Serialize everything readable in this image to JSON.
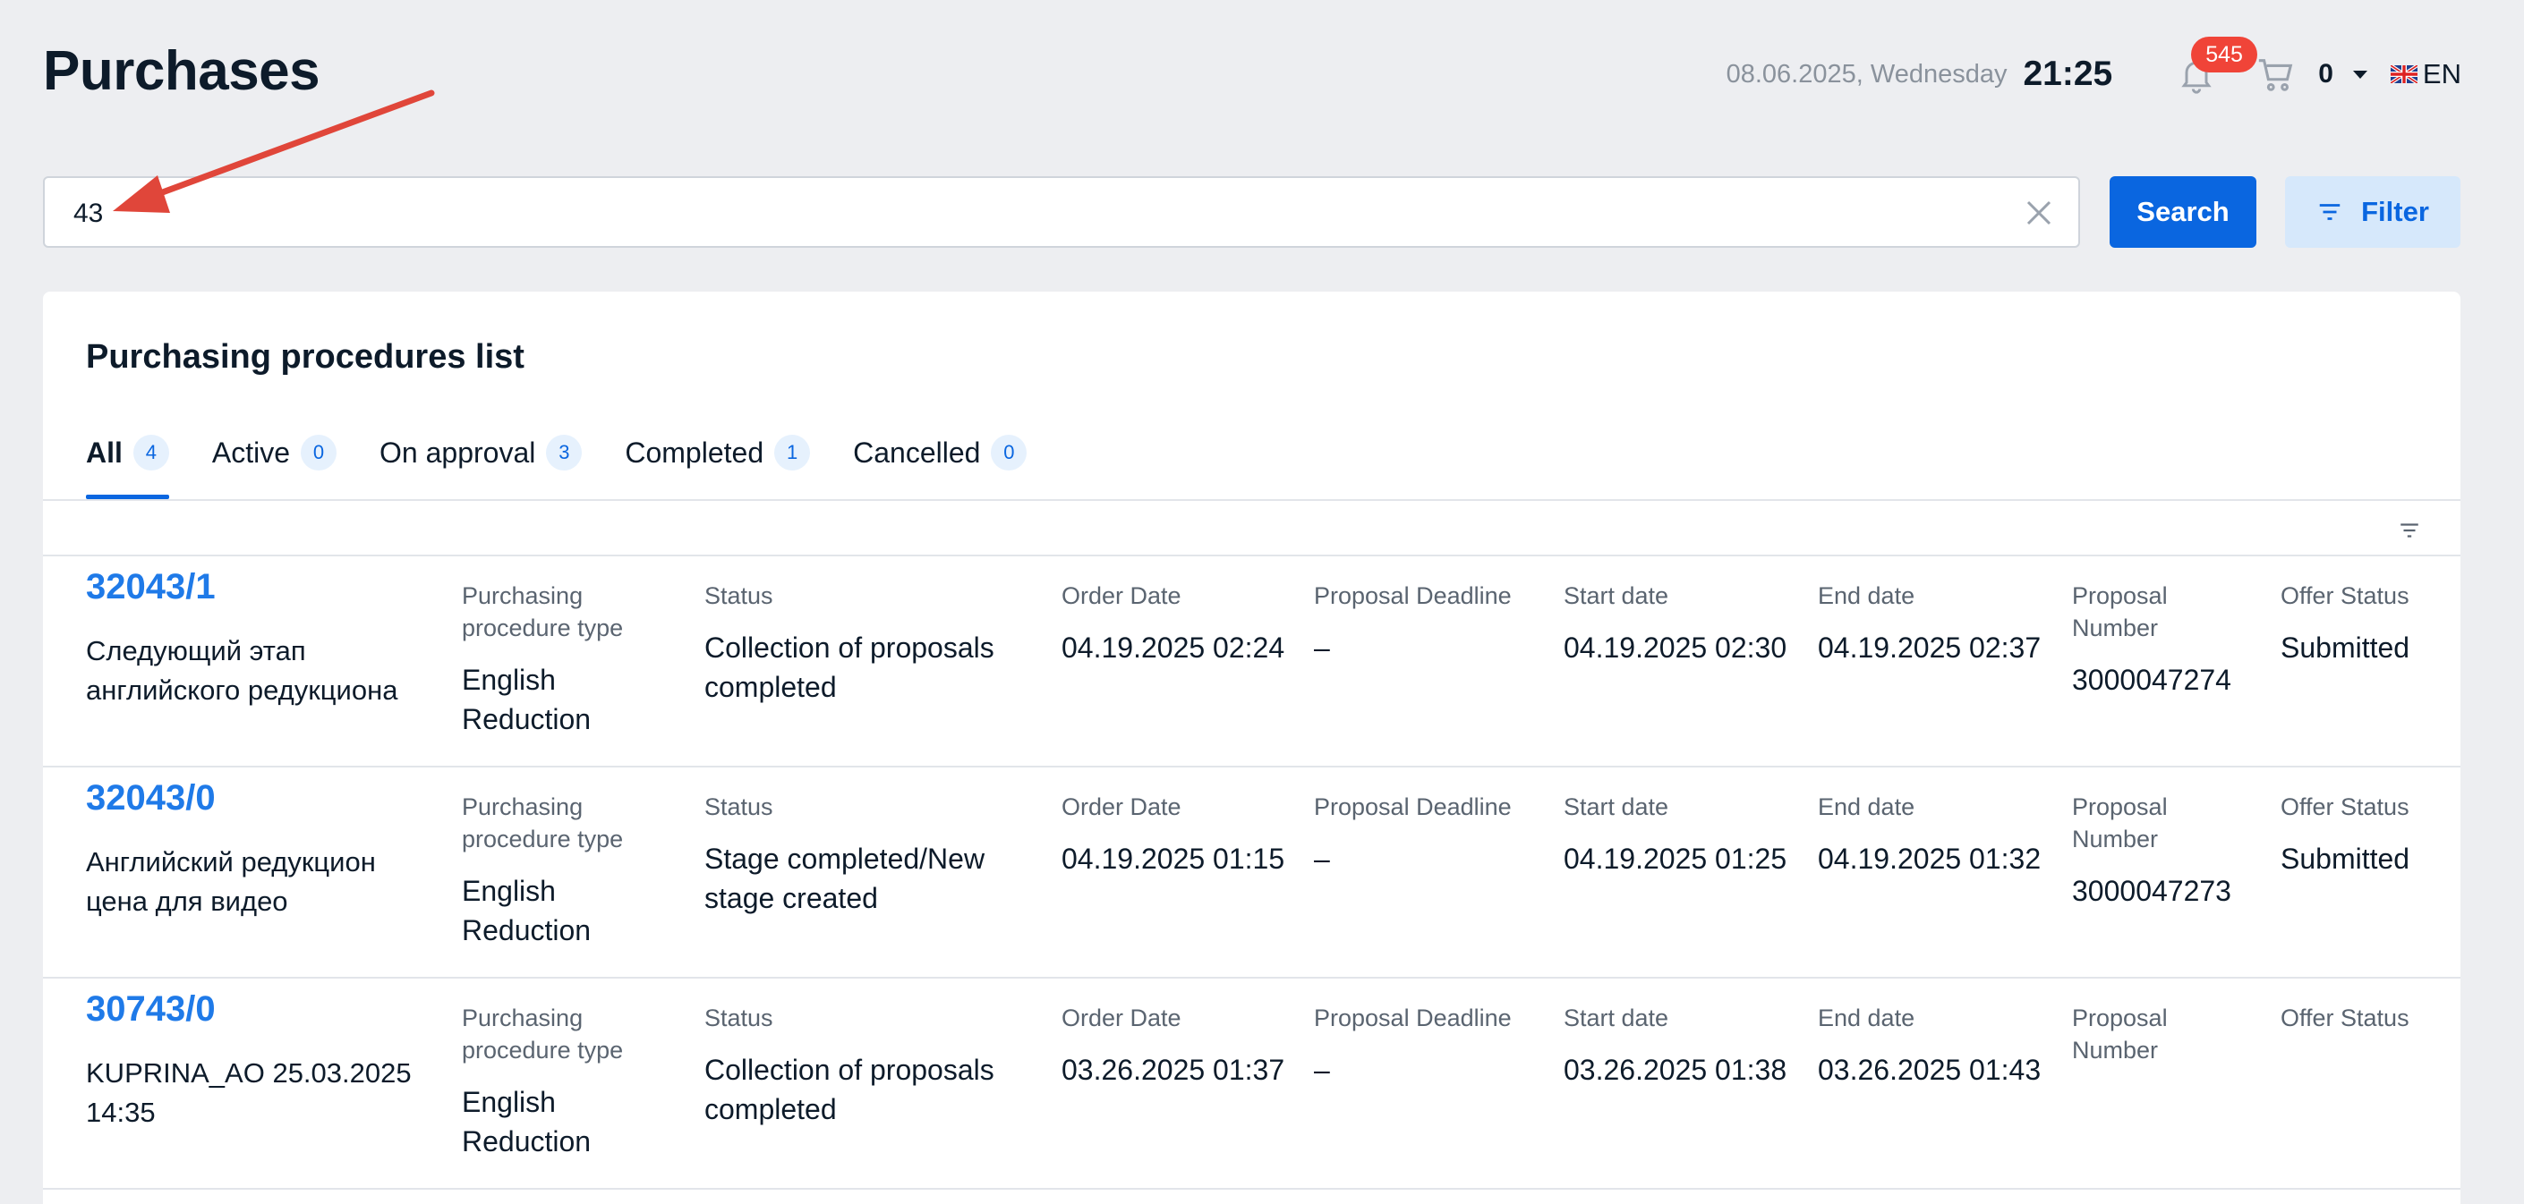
{
  "page": {
    "title": "Purchases"
  },
  "topbar": {
    "date": "08.06.2025, Wednesday",
    "time": "21:25",
    "notifications_count": "545",
    "cart_count": "0",
    "language": "EN"
  },
  "search": {
    "value": "43",
    "placeholder": "",
    "button_label": "Search"
  },
  "filter": {
    "label": "Filter"
  },
  "list": {
    "title": "Purchasing procedures list",
    "tabs": [
      {
        "label": "All",
        "count": "4"
      },
      {
        "label": "Active",
        "count": "0"
      },
      {
        "label": "On approval",
        "count": "3"
      },
      {
        "label": "Completed",
        "count": "1"
      },
      {
        "label": "Cancelled",
        "count": "0"
      }
    ],
    "headers": {
      "type": "Purchasing procedure type",
      "status": "Status",
      "order_date": "Order Date",
      "deadline": "Proposal Deadline",
      "start": "Start date",
      "end": "End date",
      "proposal_number": "Proposal Number",
      "offer_status": "Offer Status"
    },
    "rows": [
      {
        "id": "32043/1",
        "name": "Следующий этап английского редукциона",
        "type": "English Reduction",
        "status": "Collection of proposals completed",
        "order_date": "04.19.2025 02:24",
        "deadline": "–",
        "start": "04.19.2025 02:30",
        "end": "04.19.2025 02:37",
        "proposal_number": "3000047274",
        "offer_status": "Submitted"
      },
      {
        "id": "32043/0",
        "name": "Английский редукцион цена для видео",
        "type": "English Reduction",
        "status": "Stage completed/New stage created",
        "order_date": "04.19.2025 01:15",
        "deadline": "–",
        "start": "04.19.2025 01:25",
        "end": "04.19.2025 01:32",
        "proposal_number": "3000047273",
        "offer_status": "Submitted"
      },
      {
        "id": "30743/0",
        "name": "KUPRINA_AO 25.03.2025 14:35",
        "type": "English Reduction",
        "status": "Collection of proposals completed",
        "order_date": "03.26.2025 01:37",
        "deadline": "–",
        "start": "03.26.2025 01:38",
        "end": "03.26.2025 01:43",
        "proposal_number": "",
        "offer_status": ""
      }
    ]
  },
  "colors": {
    "accent": "#0a66e0",
    "link": "#1f7ae8",
    "badge": "#f04438",
    "annotation_arrow": "#e0463a"
  }
}
